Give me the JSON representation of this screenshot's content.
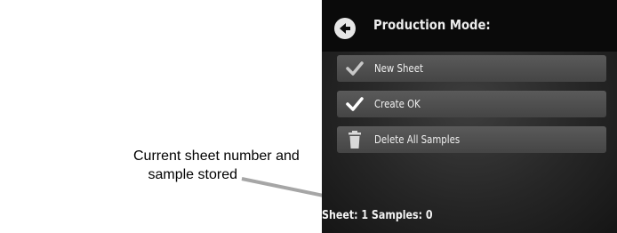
{
  "callout": {
    "line1": "Current sheet number and",
    "line2": "sample stored"
  },
  "device": {
    "title": "Production Mode:",
    "back_icon": "arrow-left-circle-icon",
    "menu": [
      {
        "label": "New Sheet",
        "icon": "check-icon",
        "icon_color": "#c8c8c8"
      },
      {
        "label": "Create OK",
        "icon": "check-icon",
        "icon_color": "#ffffff"
      },
      {
        "label": "Delete All Samples",
        "icon": "trash-icon",
        "icon_color": "#d8d8d8"
      }
    ],
    "status": {
      "sheet_label": "Sheet:",
      "sheet_value": "1",
      "samples_label": "Samples:",
      "samples_value": "0"
    }
  },
  "colors": {
    "title_bar": "#0a0a0a",
    "menu_button": "#505050",
    "arrow": "#a6a6a6"
  }
}
